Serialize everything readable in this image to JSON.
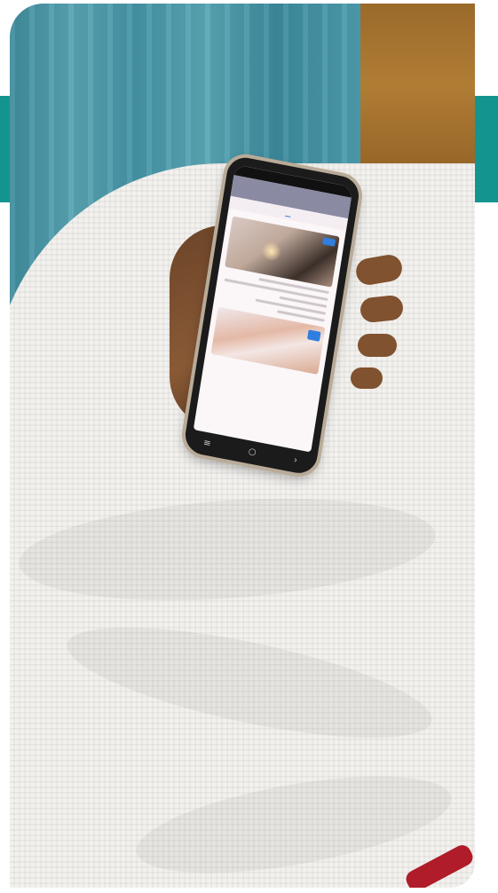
{
  "scene": {
    "description": "",
    "colors": {
      "accent_teal": "#14948f",
      "curtain": "#4b9aab",
      "blanket": "#f3f1ee",
      "app_bar": "#8a8aa2",
      "link_blue": "#2f7fe0"
    }
  },
  "phone": {
    "status_left": "",
    "status_right": "",
    "nav": {
      "menu_icon": "menu-icon",
      "home_icon": "home-icon",
      "back_icon": "back-icon"
    }
  }
}
